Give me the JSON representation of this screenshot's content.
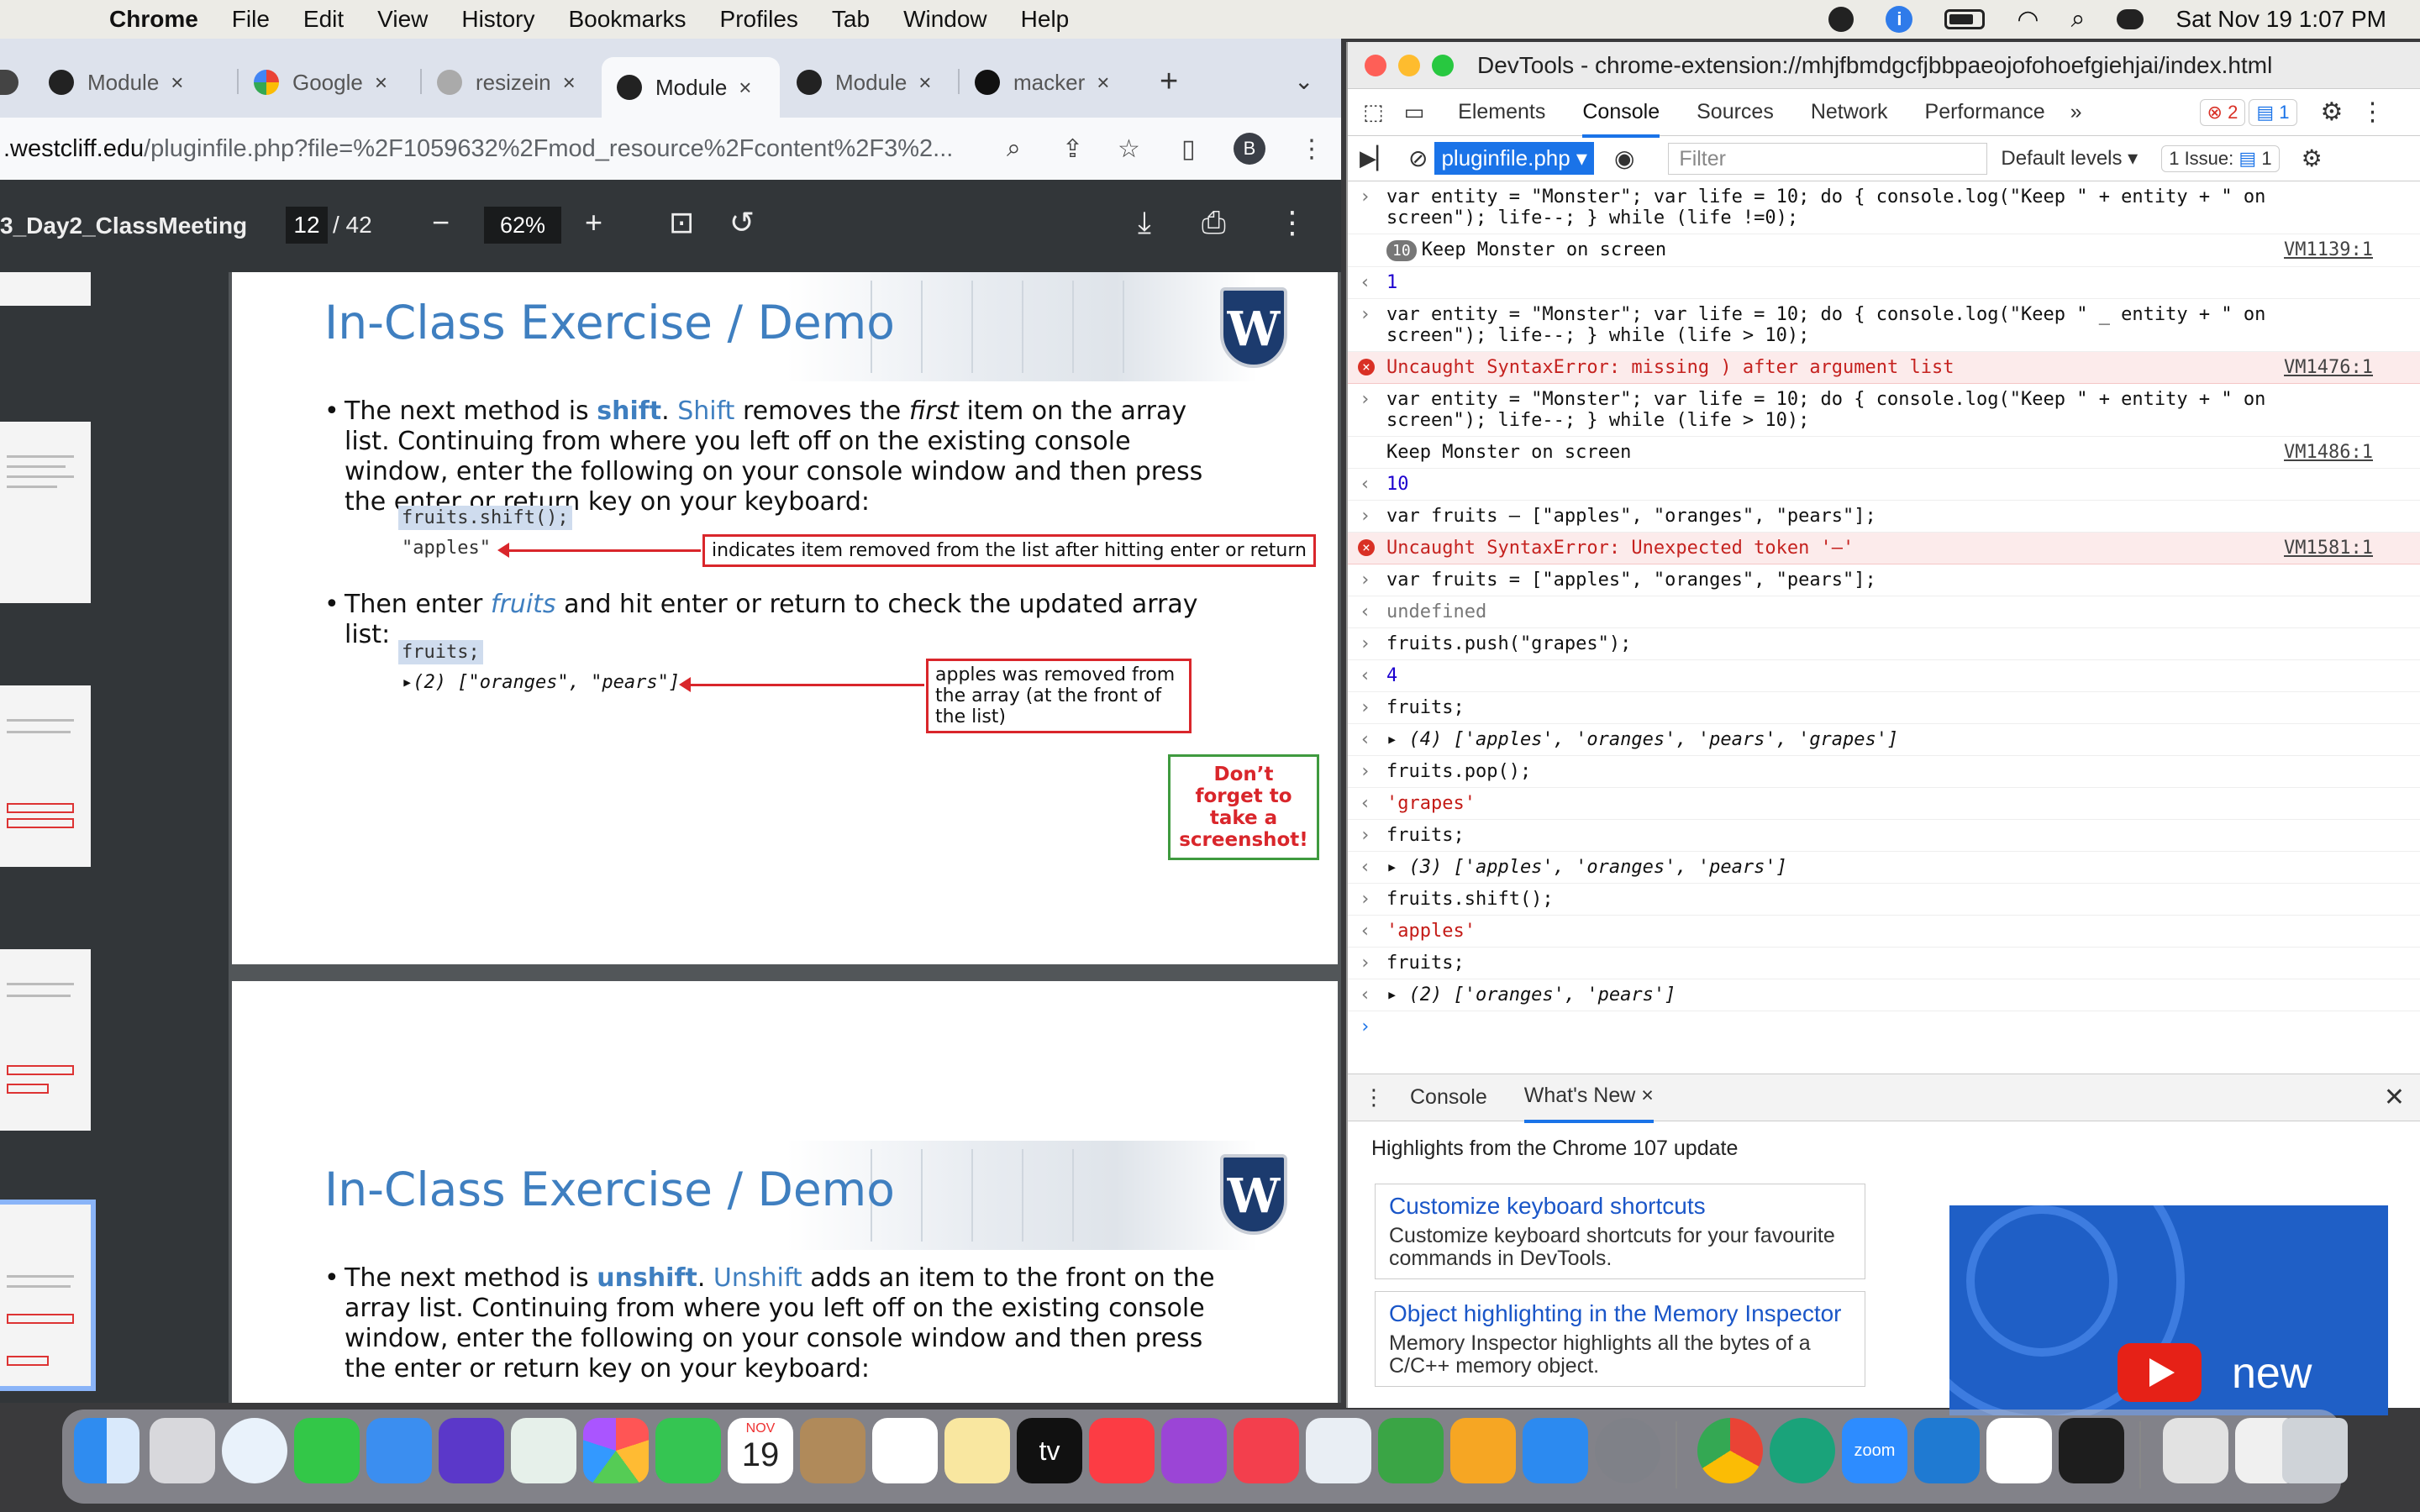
{
  "menubar": {
    "app": "Chrome",
    "items": [
      "File",
      "Edit",
      "View",
      "History",
      "Bookmarks",
      "Profiles",
      "Tab",
      "Window",
      "Help"
    ],
    "datetime": "Sat Nov 19  1:07 PM"
  },
  "browser": {
    "tabs": [
      {
        "label": "Module"
      },
      {
        "label": "Google"
      },
      {
        "label": "resizein"
      },
      {
        "label": "Module"
      },
      {
        "label": "Module"
      },
      {
        "label": "macker"
      }
    ],
    "url_domain": ".westcliff.edu",
    "url_path": "/pluginfile.php?file=%2F1059632%2Fmod_resource%2Fcontent%2F3%2...",
    "avatar": "B"
  },
  "pdf": {
    "title": "3_Day2_ClassMeeting",
    "page": "12",
    "total": "/ 42",
    "zoom": "62%"
  },
  "slide1": {
    "title": "In-Class Exercise / Demo",
    "b1_a": "The next method is ",
    "b1_kw": "shift",
    "b1_b": ". ",
    "b1_kw2": "Shift",
    "b1_c": " removes the ",
    "b1_em": "first",
    "b1_d": " item on the array list. Continuing from where you left off on the existing console window, enter the following on your console window and then press the enter or return key on your keyboard:",
    "code1": "fruits.shift();",
    "code2": "\"apples\"",
    "callout1": "indicates item removed from the list after hitting enter or return",
    "b2_a": "Then enter ",
    "b2_em": "fruits",
    "b2_b": " and hit enter or return to check the updated array list:",
    "code3": "fruits;",
    "code4": "▸(2) [\"oranges\", \"pears\"]",
    "callout2": "apples was removed from the array (at the front of the list)",
    "reminder": "Don’t forget to take a screenshot!"
  },
  "slide2": {
    "title": "In-Class Exercise / Demo",
    "b1_a": "The next method is ",
    "b1_kw": "unshift",
    "b1_b": ". ",
    "b1_kw2": "Unshift",
    "b1_c": " adds an item to the front on the array list. Continuing from where you left off on the existing console window, enter the following on your console window and then press the enter or return key on your keyboard:"
  },
  "logo_letter": "W",
  "devtools": {
    "title": "DevTools - chrome-extension://mhjfbmdgcfjbbpaeojofohoefgiehjai/index.html",
    "tabs": [
      "Elements",
      "Console",
      "Sources",
      "Network",
      "Performance"
    ],
    "errors": "2",
    "messages": "1",
    "context": "pluginfile.php ▾",
    "filter_placeholder": "Filter",
    "levels": "Default levels ▾",
    "issues": "1 Issue:",
    "issues_count": "1",
    "console": [
      {
        "t": "in",
        "text": "var entity = \"Monster\"; var life = 10; do { console.log(\"Keep \" + entity + \" on screen\"); life--; } while (life !=0);"
      },
      {
        "t": "log",
        "count": "10",
        "text": "Keep Monster on screen",
        "src": "VM1139:1"
      },
      {
        "t": "out",
        "text": "1",
        "num": true
      },
      {
        "t": "in",
        "text": "var entity = \"Monster\"; var life = 10; do { console.log(\"Keep \" _ entity + \" on screen\"); life--; } while (life > 10);"
      },
      {
        "t": "err",
        "text": "Uncaught SyntaxError: missing ) after argument list",
        "src": "VM1476:1"
      },
      {
        "t": "in",
        "text": "var entity = \"Monster\"; var life = 10; do { console.log(\"Keep \" + entity + \" on screen\"); life--; } while (life > 10);"
      },
      {
        "t": "log",
        "text": "Keep Monster on screen",
        "src": "VM1486:1"
      },
      {
        "t": "out",
        "text": "10",
        "num": true
      },
      {
        "t": "in",
        "text": "var fruits – [\"apples\", \"oranges\", \"pears\"];"
      },
      {
        "t": "err",
        "text": "Uncaught SyntaxError: Unexpected token '–'",
        "src": "VM1581:1"
      },
      {
        "t": "in",
        "text": "var fruits = [\"apples\", \"oranges\", \"pears\"];"
      },
      {
        "t": "out",
        "text": "undefined",
        "gray": true
      },
      {
        "t": "in",
        "text": "fruits.push(\"grapes\");"
      },
      {
        "t": "out",
        "text": "4",
        "num": true
      },
      {
        "t": "in",
        "text": "fruits;"
      },
      {
        "t": "out",
        "text": "▸ (4) ['apples', 'oranges', 'pears', 'grapes']",
        "obj": true
      },
      {
        "t": "in",
        "text": "fruits.pop();"
      },
      {
        "t": "out",
        "text": "'grapes'",
        "str": true
      },
      {
        "t": "in",
        "text": "fruits;"
      },
      {
        "t": "out",
        "text": "▸ (3) ['apples', 'oranges', 'pears']",
        "obj": true
      },
      {
        "t": "in",
        "text": "fruits.shift();"
      },
      {
        "t": "out",
        "text": "'apples'",
        "str": true
      },
      {
        "t": "in",
        "text": "fruits;"
      },
      {
        "t": "out",
        "text": "▸ (2) ['oranges', 'pears']",
        "obj": true
      }
    ],
    "drawer": {
      "tabs": [
        "Console",
        "What's New"
      ],
      "highlights": "Highlights from the Chrome 107 update",
      "cards": [
        {
          "title": "Customize keyboard shortcuts",
          "desc": "Customize keyboard shortcuts for your favourite commands in DevTools."
        },
        {
          "title": "Object highlighting in the Memory Inspector",
          "desc": "Memory Inspector highlights all the bytes of a C/C++ memory object."
        }
      ],
      "video_label": "new"
    }
  },
  "dock": {
    "calendar_month": "NOV",
    "calendar_day": "19",
    "tv_label": "tv",
    "zoom_label": "zoom"
  }
}
